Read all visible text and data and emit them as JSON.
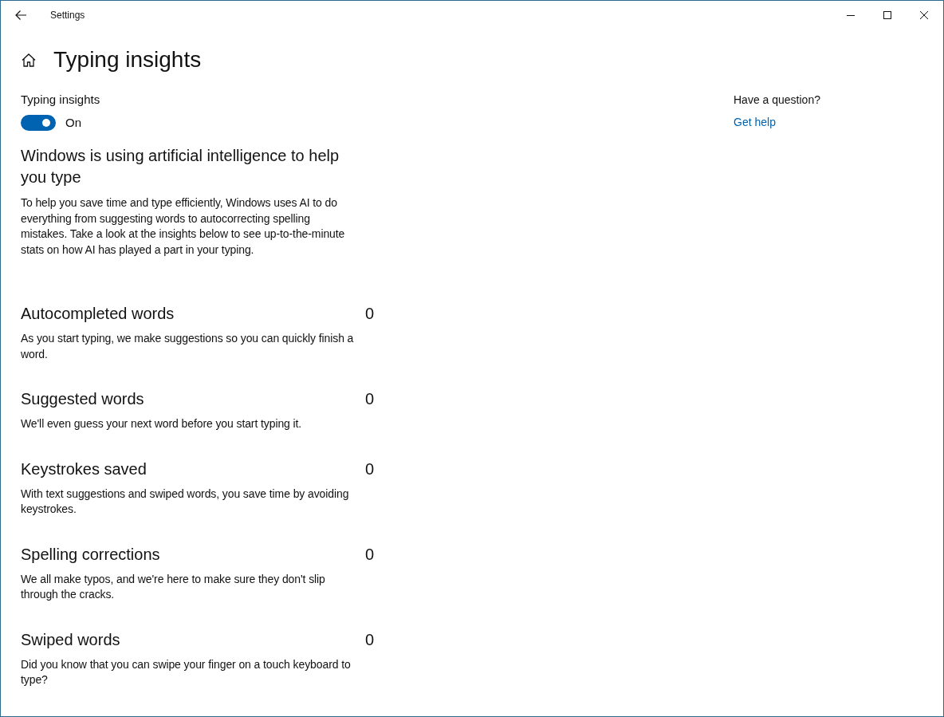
{
  "window": {
    "title": "Settings"
  },
  "page": {
    "title": "Typing insights"
  },
  "toggle": {
    "label": "Typing insights",
    "on": true,
    "state_text": "On"
  },
  "intro": {
    "heading": "Windows is using artificial intelligence to help you type",
    "text": "To help you save time and type efficiently, Windows uses AI to do everything from suggesting words to autocorrecting spelling mistakes. Take a look at the insights below to see up-to-the-minute stats on how AI has played a part in your typing."
  },
  "insights": [
    {
      "title": "Autocompleted words",
      "count": "0",
      "description": "As you start typing, we make suggestions so you can quickly finish a word."
    },
    {
      "title": "Suggested words",
      "count": "0",
      "description": "We'll even guess your next word before you start typing it."
    },
    {
      "title": "Keystrokes saved",
      "count": "0",
      "description": "With text suggestions and swiped words, you save time by avoiding keystrokes."
    },
    {
      "title": "Spelling corrections",
      "count": "0",
      "description": "We all make typos, and we're here to make sure they don't slip through the cracks."
    },
    {
      "title": "Swiped words",
      "count": "0",
      "description": "Did you know that you can swipe your finger on a touch keyboard to type?"
    }
  ],
  "help": {
    "question": "Have a question?",
    "link": "Get help"
  }
}
